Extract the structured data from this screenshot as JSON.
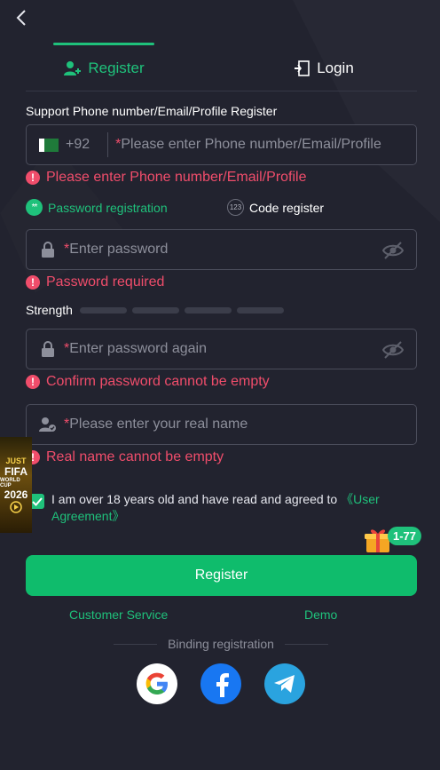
{
  "tabs": {
    "register": "Register",
    "login": "Login"
  },
  "account": {
    "label": "Support Phone number/Email/Profile Register",
    "dial_code": "+92",
    "placeholder": "Please enter Phone number/Email/Profile",
    "error": "Please enter Phone number/Email/Profile"
  },
  "modes": {
    "password": "Password registration",
    "code": "Code register"
  },
  "password": {
    "placeholder": "Enter password",
    "error": "Password required"
  },
  "strength": {
    "label": "Strength",
    "level": 0
  },
  "confirm": {
    "placeholder": "Enter password again",
    "error": "Confirm password cannot be empty"
  },
  "realname": {
    "placeholder": "Please enter your real name",
    "error": "Real name cannot be empty"
  },
  "required_mark": "*",
  "agreement": {
    "checked": true,
    "text": "I am over 18 years old and have read and agreed to ",
    "link": "《User Agreement》"
  },
  "promo": {
    "line1": "JUST",
    "line2": "FIFA",
    "line3": "WORLD CUP",
    "line4": "2026"
  },
  "gift_badge": "1-77",
  "register_button": "Register",
  "links": {
    "customer_service": "Customer Service",
    "demo": "Demo"
  },
  "binding_label": "Binding registration",
  "social": [
    "google-icon",
    "facebook-icon",
    "telegram-icon"
  ],
  "colors": {
    "accent": "#1fc17b",
    "error": "#f04d6b",
    "background": "#22232f",
    "button": "#0fbc6c"
  }
}
